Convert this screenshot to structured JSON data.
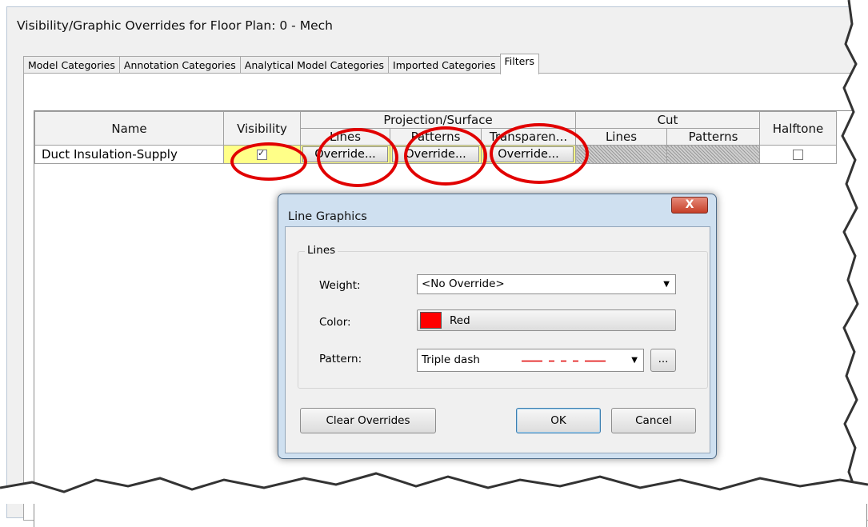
{
  "window": {
    "title": "Visibility/Graphic Overrides for Floor Plan: 0 - Mech"
  },
  "tabs": [
    {
      "label": "Model Categories"
    },
    {
      "label": "Annotation Categories"
    },
    {
      "label": "Analytical Model Categories"
    },
    {
      "label": "Imported Categories"
    },
    {
      "label": "Filters",
      "active": true
    }
  ],
  "table": {
    "headers": {
      "name": "Name",
      "visibility": "Visibility",
      "projection_surface": "Projection/Surface",
      "cut": "Cut",
      "halftone": "Halftone",
      "proj_lines": "Lines",
      "proj_patterns": "Patterns",
      "proj_transparency": "Transparen...",
      "cut_lines": "Lines",
      "cut_patterns": "Patterns"
    },
    "rows": [
      {
        "name": "Duct Insulation-Supply",
        "visible": true,
        "proj_lines": "Override...",
        "proj_patterns": "Override...",
        "proj_transparency": "Override...",
        "halftone": false
      }
    ]
  },
  "dialog": {
    "title": "Line Graphics",
    "close_glyph": "X",
    "group_label": "Lines",
    "weight_label": "Weight:",
    "weight_value": "<No Override>",
    "color_label": "Color:",
    "color_value": "Red",
    "color_hex": "#ff0000",
    "pattern_label": "Pattern:",
    "pattern_value": "Triple dash",
    "ellipsis_label": "...",
    "clear_overrides": "Clear Overrides",
    "ok": "OK",
    "cancel": "Cancel"
  },
  "colors": {
    "highlight": "#ffff88",
    "annotation_red": "#e10000",
    "dialog_frame": "#cfe0f0"
  }
}
